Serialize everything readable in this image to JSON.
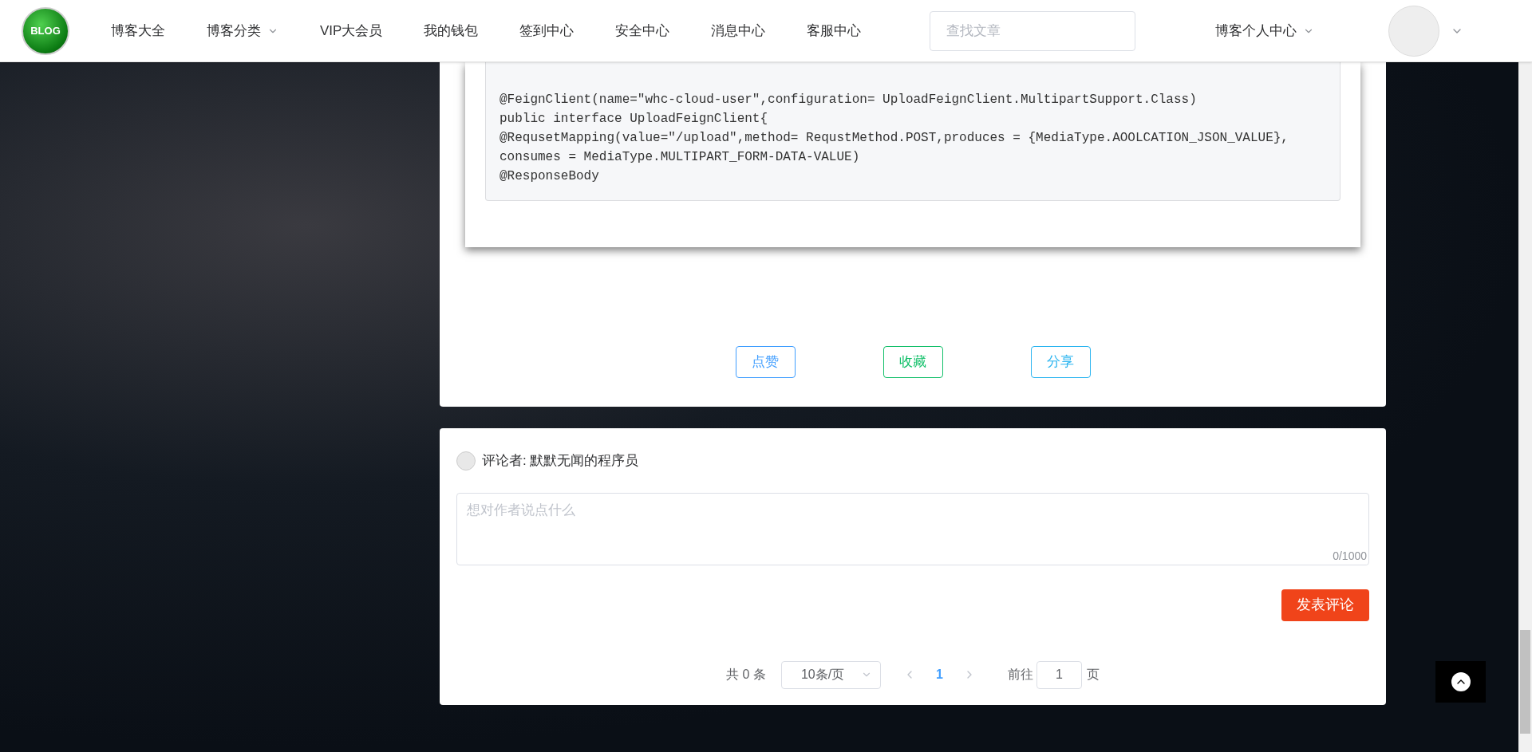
{
  "header": {
    "logo_text": "BLOG",
    "nav": [
      {
        "label": "博客大全",
        "has_dropdown": false
      },
      {
        "label": "博客分类",
        "has_dropdown": true
      },
      {
        "label": "VIP大会员",
        "has_dropdown": false
      },
      {
        "label": "我的钱包",
        "has_dropdown": false
      },
      {
        "label": "签到中心",
        "has_dropdown": false
      },
      {
        "label": "安全中心",
        "has_dropdown": false
      },
      {
        "label": "消息中心",
        "has_dropdown": false
      },
      {
        "label": "客服中心",
        "has_dropdown": false
      }
    ],
    "search": {
      "placeholder": "查找文章"
    },
    "user_menu": {
      "label": "博客个人中心",
      "has_dropdown": true
    }
  },
  "article": {
    "code_lines": [
      "@FeignClient(name=\"whc-cloud-user\",configuration= UploadFeignClient.MultipartSupport.Class)",
      "public interface UploadFeignClient{",
      "@RequsetMapping(value=\"/upload\",method= RequstMethod.POST,produces = {MediaType.AOOLCATION_JSON_VALUE},",
      "consumes = MediaType.MULTIPART_FORM-DATA-VALUE)",
      "@ResponseBody"
    ],
    "actions": [
      {
        "label": "点赞",
        "color": "#409eff"
      },
      {
        "label": "收藏",
        "color": "#13c06a"
      },
      {
        "label": "分享",
        "color": "#2ab4f0"
      }
    ]
  },
  "comment": {
    "commenter": "评论者: 默默无闻的程序员",
    "placeholder": "想对作者说点什么",
    "counter": "0/1000",
    "submit": "发表评论"
  },
  "pagination": {
    "total": "共 0 条",
    "page_size": "10条/页",
    "pages": [
      {
        "label": "1",
        "selected": true
      }
    ],
    "goto_label": "前往",
    "goto_value": "1",
    "page_suffix": "页"
  }
}
